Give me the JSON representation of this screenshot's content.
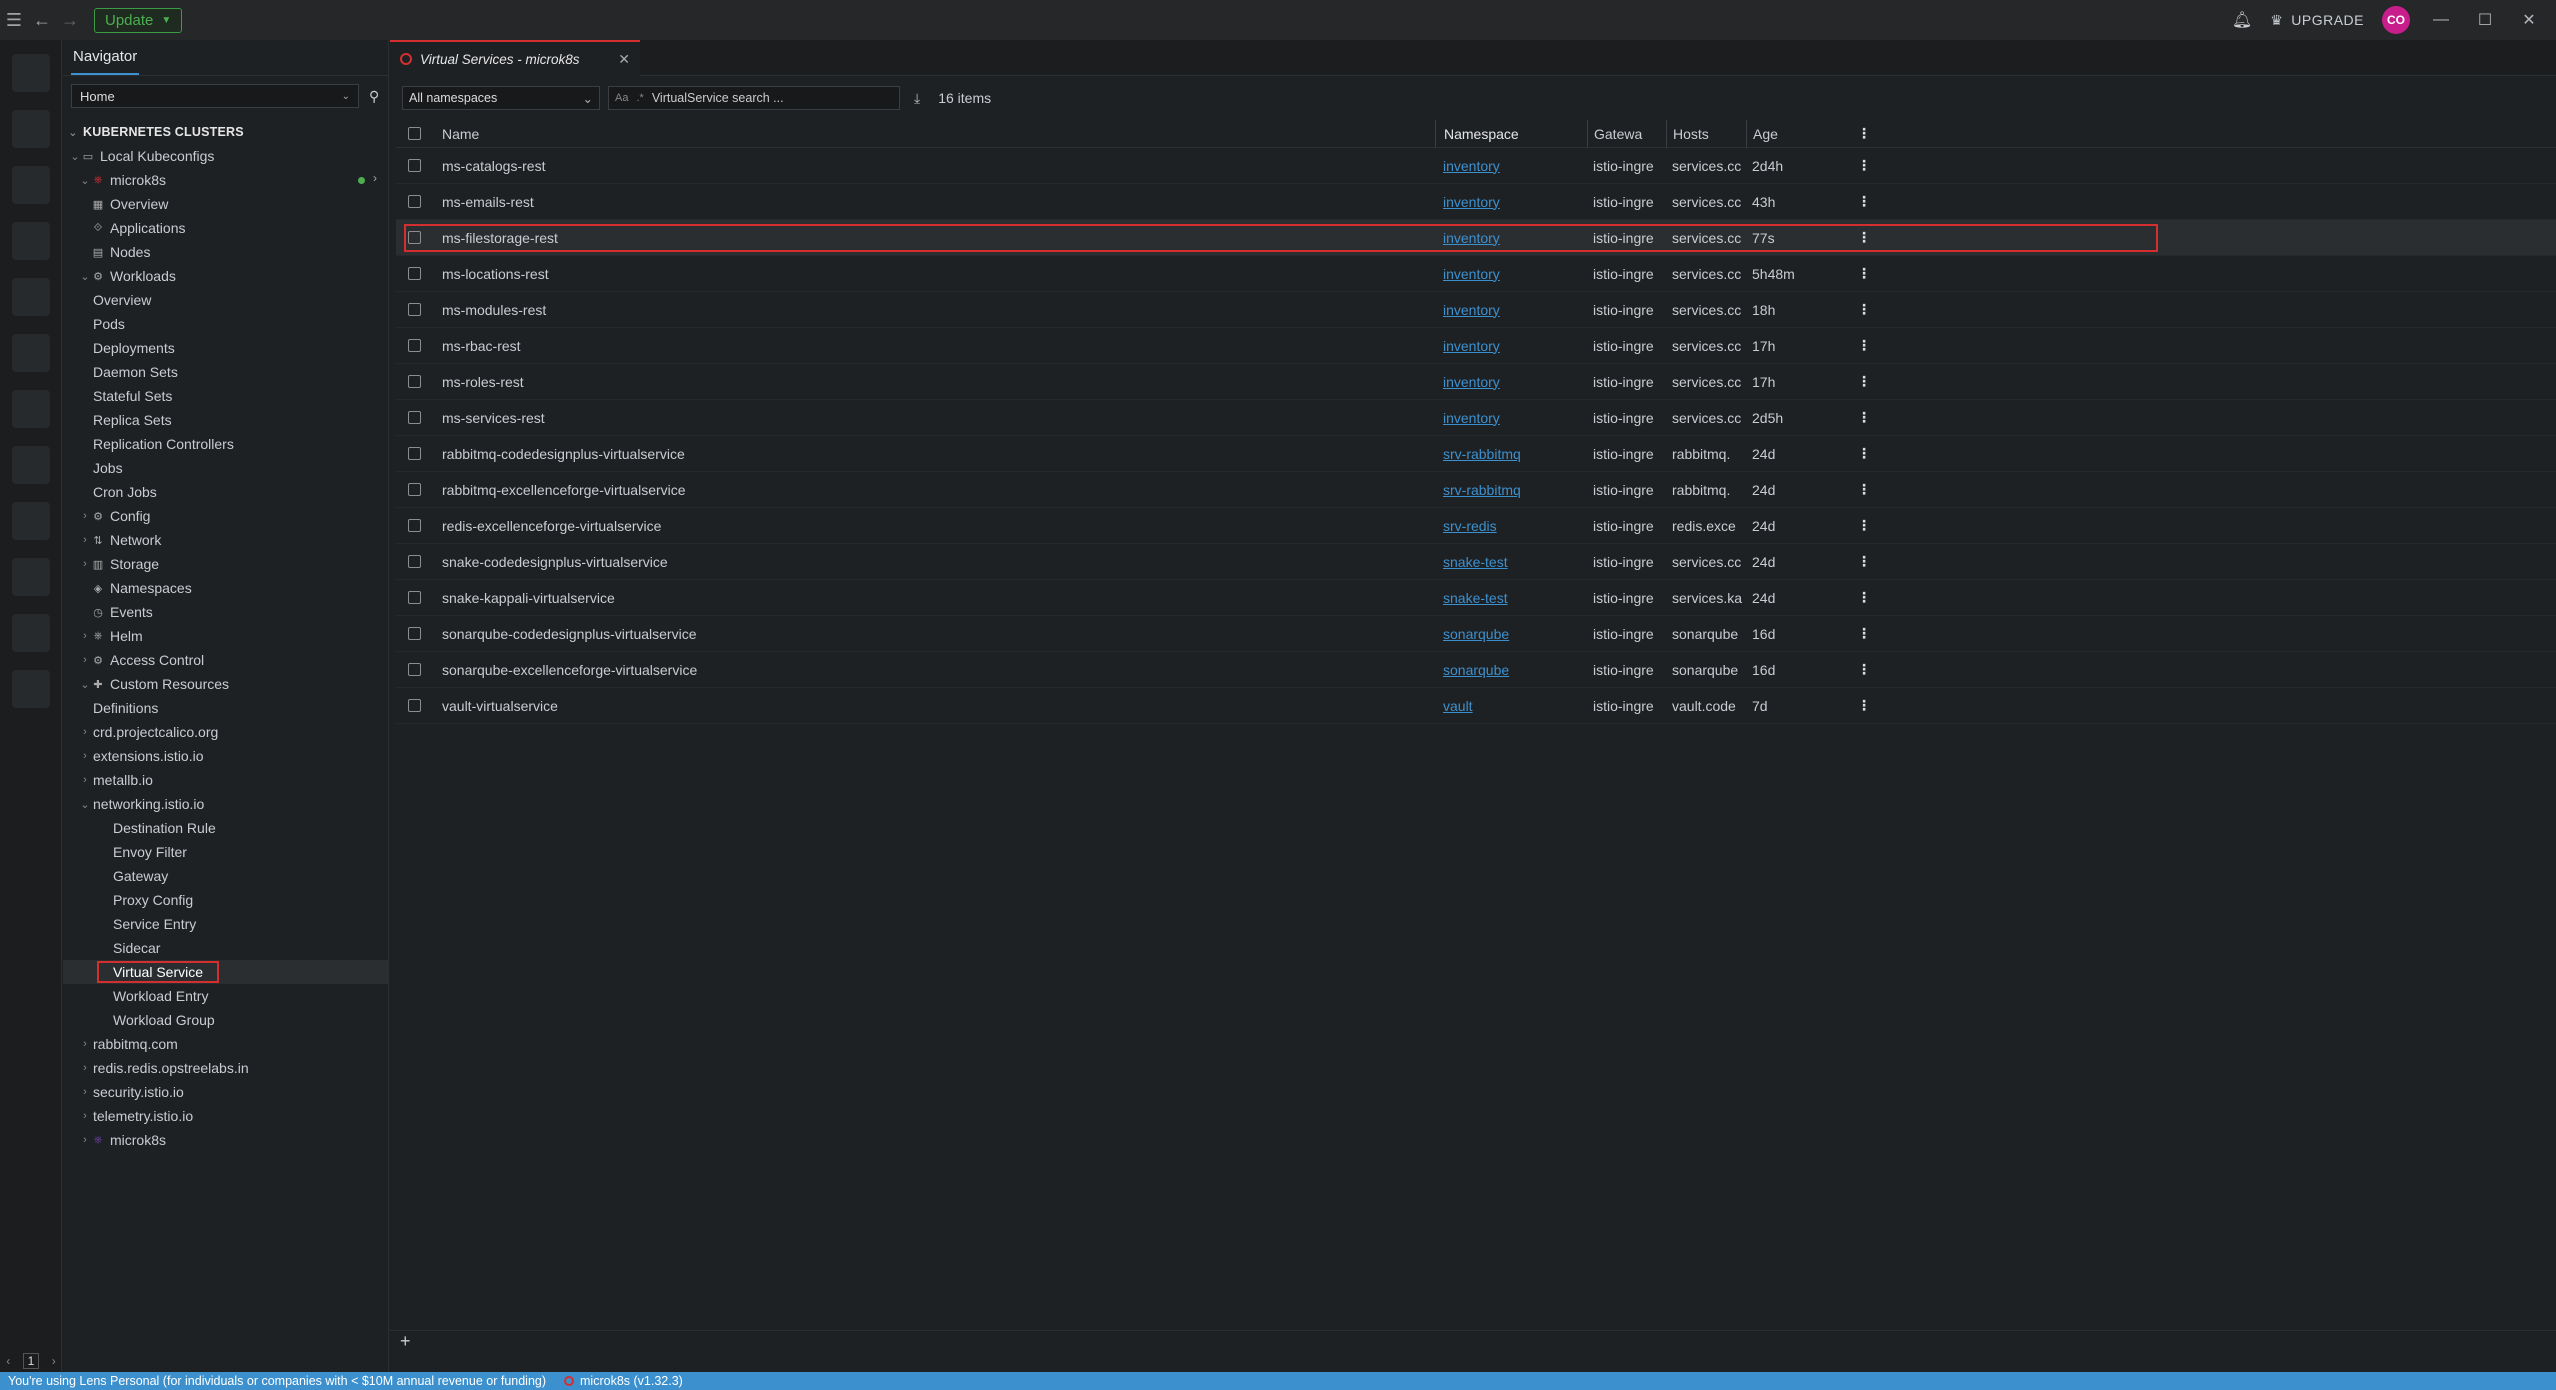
{
  "topbar": {
    "update_label": "Update",
    "upgrade_label": "UPGRADE",
    "avatar_initials": "CO"
  },
  "navigator": {
    "title": "Navigator",
    "home_value": "Home",
    "clusters_header": "KUBERNETES CLUSTERS",
    "tree": [
      {
        "label": "Local Kubeconfigs",
        "level": 1,
        "arrow": "v",
        "icon": "laptop-icon"
      },
      {
        "label": "microk8s",
        "level": 2,
        "arrow": "v",
        "icon": "k8s-icon"
      },
      {
        "label": "Overview",
        "level": 3,
        "arrow": "",
        "icon": "grid-icon"
      },
      {
        "label": "Applications",
        "level": 3,
        "arrow": "",
        "icon": "apps-icon"
      },
      {
        "label": "Nodes",
        "level": 3,
        "arrow": "",
        "icon": "nodes-icon"
      },
      {
        "label": "Workloads",
        "level": 3,
        "arrow": "v",
        "icon": "workloads-icon"
      },
      {
        "label": "Overview",
        "level": 4,
        "arrow": "",
        "icon": ""
      },
      {
        "label": "Pods",
        "level": 4,
        "arrow": "",
        "icon": ""
      },
      {
        "label": "Deployments",
        "level": 4,
        "arrow": "",
        "icon": ""
      },
      {
        "label": "Daemon Sets",
        "level": 4,
        "arrow": "",
        "icon": ""
      },
      {
        "label": "Stateful Sets",
        "level": 4,
        "arrow": "",
        "icon": ""
      },
      {
        "label": "Replica Sets",
        "level": 4,
        "arrow": "",
        "icon": ""
      },
      {
        "label": "Replication Controllers",
        "level": 4,
        "arrow": "",
        "icon": ""
      },
      {
        "label": "Jobs",
        "level": 4,
        "arrow": "",
        "icon": ""
      },
      {
        "label": "Cron Jobs",
        "level": 4,
        "arrow": "",
        "icon": ""
      },
      {
        "label": "Config",
        "level": 3,
        "arrow": ">",
        "icon": "config-icon"
      },
      {
        "label": "Network",
        "level": 3,
        "arrow": ">",
        "icon": "network-icon"
      },
      {
        "label": "Storage",
        "level": 3,
        "arrow": ">",
        "icon": "storage-icon"
      },
      {
        "label": "Namespaces",
        "level": 3,
        "arrow": "",
        "icon": "namespaces-icon"
      },
      {
        "label": "Events",
        "level": 3,
        "arrow": "",
        "icon": "events-icon"
      },
      {
        "label": "Helm",
        "level": 3,
        "arrow": ">",
        "icon": "helm-icon"
      },
      {
        "label": "Access Control",
        "level": 3,
        "arrow": ">",
        "icon": "access-icon"
      },
      {
        "label": "Custom Resources",
        "level": 3,
        "arrow": "v",
        "icon": "puzzle-icon"
      },
      {
        "label": "Definitions",
        "level": 4,
        "arrow": "",
        "icon": ""
      },
      {
        "label": "crd.projectcalico.org",
        "level": 4,
        "arrow": ">",
        "icon": ""
      },
      {
        "label": "extensions.istio.io",
        "level": 4,
        "arrow": ">",
        "icon": ""
      },
      {
        "label": "metallb.io",
        "level": 4,
        "arrow": ">",
        "icon": ""
      },
      {
        "label": "networking.istio.io",
        "level": 4,
        "arrow": "v",
        "icon": ""
      },
      {
        "label": "Destination Rule",
        "level": 5,
        "arrow": "",
        "icon": ""
      },
      {
        "label": "Envoy Filter",
        "level": 5,
        "arrow": "",
        "icon": ""
      },
      {
        "label": "Gateway",
        "level": 5,
        "arrow": "",
        "icon": ""
      },
      {
        "label": "Proxy Config",
        "level": 5,
        "arrow": "",
        "icon": ""
      },
      {
        "label": "Service Entry",
        "level": 5,
        "arrow": "",
        "icon": ""
      },
      {
        "label": "Sidecar",
        "level": 5,
        "arrow": "",
        "icon": ""
      },
      {
        "label": "Virtual Service",
        "level": 5,
        "arrow": "",
        "icon": "",
        "selected": true
      },
      {
        "label": "Workload Entry",
        "level": 5,
        "arrow": "",
        "icon": ""
      },
      {
        "label": "Workload Group",
        "level": 5,
        "arrow": "",
        "icon": ""
      },
      {
        "label": "rabbitmq.com",
        "level": 4,
        "arrow": ">",
        "icon": ""
      },
      {
        "label": "redis.redis.opstreelabs.in",
        "level": 4,
        "arrow": ">",
        "icon": ""
      },
      {
        "label": "security.istio.io",
        "level": 4,
        "arrow": ">",
        "icon": ""
      },
      {
        "label": "telemetry.istio.io",
        "level": 4,
        "arrow": ">",
        "icon": ""
      },
      {
        "label": "microk8s",
        "level": 2,
        "arrow": ">",
        "icon": "k8s-icon-purple"
      }
    ]
  },
  "tab": {
    "title": "Virtual Services - microk8s"
  },
  "toolbar": {
    "namespace_select": "All namespaces",
    "search_placeholder": "VirtualService search ...",
    "items_count": "16 items"
  },
  "table": {
    "headers": {
      "name": "Name",
      "namespace": "Namespace",
      "gateways": "Gatewa",
      "hosts": "Hosts",
      "age": "Age"
    },
    "rows": [
      {
        "name": "ms-catalogs-rest",
        "namespace": "inventory",
        "gateways": "istio-ingre",
        "hosts": "services.cc",
        "age": "2d4h"
      },
      {
        "name": "ms-emails-rest",
        "namespace": "inventory",
        "gateways": "istio-ingre",
        "hosts": "services.cc",
        "age": "43h"
      },
      {
        "name": "ms-filestorage-rest",
        "namespace": "inventory",
        "gateways": "istio-ingre",
        "hosts": "services.cc",
        "age": "77s",
        "highlighted": true
      },
      {
        "name": "ms-locations-rest",
        "namespace": "inventory",
        "gateways": "istio-ingre",
        "hosts": "services.cc",
        "age": "5h48m"
      },
      {
        "name": "ms-modules-rest",
        "namespace": "inventory",
        "gateways": "istio-ingre",
        "hosts": "services.cc",
        "age": "18h"
      },
      {
        "name": "ms-rbac-rest",
        "namespace": "inventory",
        "gateways": "istio-ingre",
        "hosts": "services.cc",
        "age": "17h"
      },
      {
        "name": "ms-roles-rest",
        "namespace": "inventory",
        "gateways": "istio-ingre",
        "hosts": "services.cc",
        "age": "17h"
      },
      {
        "name": "ms-services-rest",
        "namespace": "inventory",
        "gateways": "istio-ingre",
        "hosts": "services.cc",
        "age": "2d5h"
      },
      {
        "name": "rabbitmq-codedesignplus-virtualservice",
        "namespace": "srv-rabbitmq",
        "gateways": "istio-ingre",
        "hosts": "rabbitmq.",
        "age": "24d"
      },
      {
        "name": "rabbitmq-excellenceforge-virtualservice",
        "namespace": "srv-rabbitmq",
        "gateways": "istio-ingre",
        "hosts": "rabbitmq.",
        "age": "24d"
      },
      {
        "name": "redis-excellenceforge-virtualservice",
        "namespace": "srv-redis",
        "gateways": "istio-ingre",
        "hosts": "redis.exce",
        "age": "24d"
      },
      {
        "name": "snake-codedesignplus-virtualservice",
        "namespace": "snake-test",
        "gateways": "istio-ingre",
        "hosts": "services.cc",
        "age": "24d"
      },
      {
        "name": "snake-kappali-virtualservice",
        "namespace": "snake-test",
        "gateways": "istio-ingre",
        "hosts": "services.ka",
        "age": "24d"
      },
      {
        "name": "sonarqube-codedesignplus-virtualservice",
        "namespace": "sonarqube",
        "gateways": "istio-ingre",
        "hosts": "sonarqube",
        "age": "16d"
      },
      {
        "name": "sonarqube-excellenceforge-virtualservice",
        "namespace": "sonarqube",
        "gateways": "istio-ingre",
        "hosts": "sonarqube",
        "age": "16d"
      },
      {
        "name": "vault-virtualservice",
        "namespace": "vault",
        "gateways": "istio-ingre",
        "hosts": "vault.code",
        "age": "7d"
      }
    ]
  },
  "rail": {
    "page": "1"
  },
  "statusbar": {
    "message": "You're using Lens Personal (for individuals or companies with < $10M annual revenue or funding)",
    "cluster": "microk8s (v1.32.3)"
  },
  "colors": {
    "accent": "#3d90ce",
    "highlight_box": "#d32f2f",
    "update_green": "#4caf50"
  }
}
